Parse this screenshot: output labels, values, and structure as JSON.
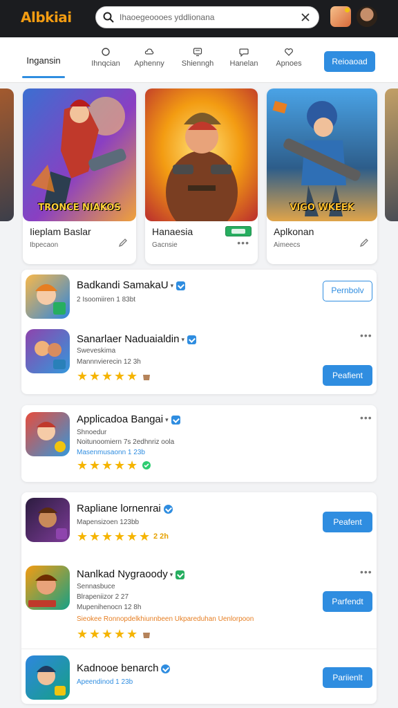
{
  "header": {
    "logo_text": "Albkiai",
    "search_placeholder": "Ihaoegeoooes yddlionana"
  },
  "nav": {
    "active_tab": "Ingansin",
    "tabs": [
      {
        "label": "Ihnqcian",
        "icon": "circle-icon"
      },
      {
        "label": "Aphenny",
        "icon": "cloud-icon"
      },
      {
        "label": "Shienngh",
        "icon": "monitor-icon"
      },
      {
        "label": "Hanelan",
        "icon": "chat-icon"
      },
      {
        "label": "Apnoes",
        "icon": "heart-icon"
      }
    ],
    "button_label": "Reioaoad"
  },
  "featured": [
    {
      "banner": "TRONCE NIAKOS",
      "title": "Iieplam Baslar",
      "subtitle": "Ibpecaon"
    },
    {
      "banner": "",
      "title": "Hanaesia",
      "subtitle": "Gacnsie"
    },
    {
      "banner": "VIGO WKEEK",
      "title": "Aplkonan",
      "subtitle": "Aimeecs"
    }
  ],
  "list": [
    {
      "name": "Badkandi SamakaU",
      "lines": [
        "2  Isoomiiren 1 83bt"
      ],
      "button": "Pernbolv",
      "button_style": "outline"
    },
    {
      "name": "Sanarlaer Naduaialdin",
      "lines": [
        "Sweveskima",
        "Mannnvierecin 12 3h"
      ],
      "rating_text": "",
      "button": "Peafient"
    },
    {
      "name": "Applicadoa Bangai",
      "lines": [
        "Shnoedur",
        "Noitunoomiern 7s 2edhnriz oola"
      ],
      "blue_line": "Masenmusaonn 1 23b",
      "rating_text": ""
    },
    {
      "name": "Rapliane lornenrai",
      "lines": [
        "Mapensizoen 123bb"
      ],
      "rating_text": "2 2h",
      "button": "Peafent"
    },
    {
      "name": "Nanlkad Nygraoody",
      "lines": [
        "Sennasbuce",
        "Blrapeniizor 2 27",
        "Mupenihenocn 12 8h"
      ],
      "orange_line": "Sieokee Ronnopdelkhiunnbeen Ukpareduhan Uenlorpoon",
      "button": "Parfendt"
    },
    {
      "name": "Kadnooe benarch",
      "blue_line": "Apeendinod 1 23b",
      "button": "Pariienlt"
    }
  ],
  "colors": {
    "accent": "#2f8de0",
    "star": "#f5b400",
    "header_bg": "#1b1c1f"
  }
}
